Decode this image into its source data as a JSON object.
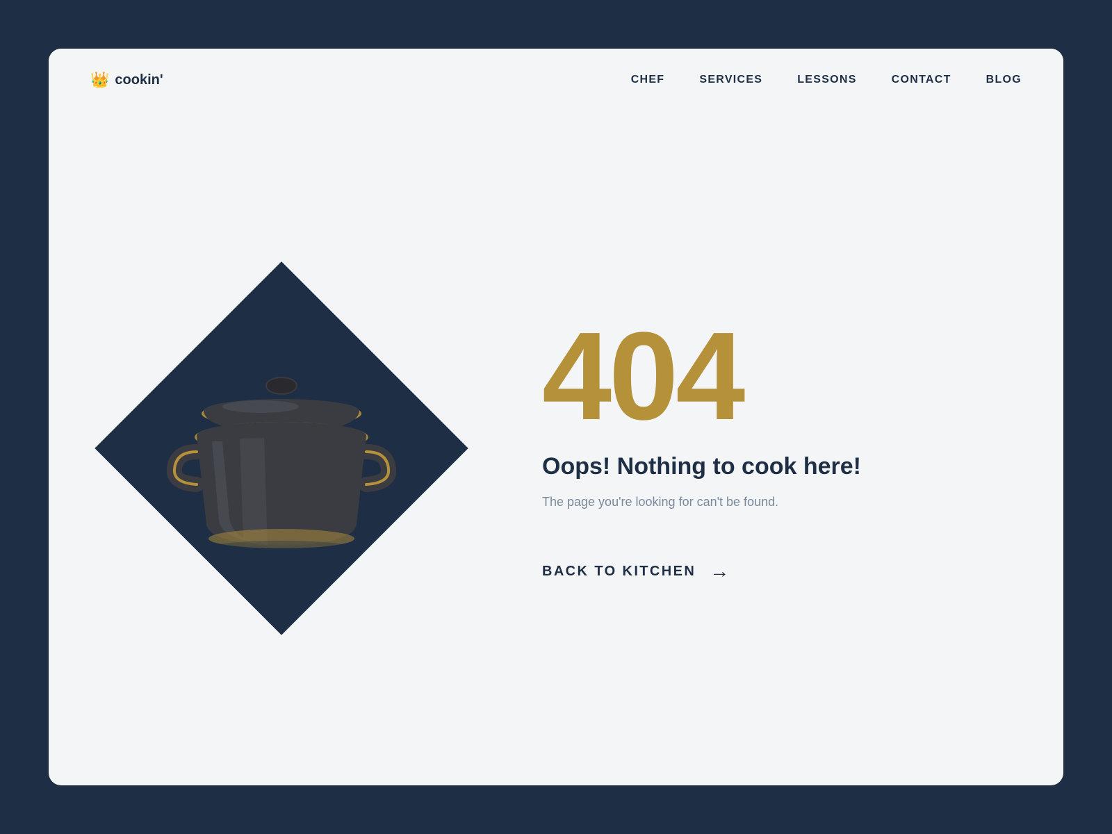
{
  "header": {
    "logo_text": "cookin'",
    "logo_icon": "👑",
    "nav_items": [
      {
        "label": "CHEF",
        "id": "chef"
      },
      {
        "label": "SERVICES",
        "id": "services"
      },
      {
        "label": "LESSONS",
        "id": "lessons"
      },
      {
        "label": "CONTACT",
        "id": "contact"
      },
      {
        "label": "BLOG",
        "id": "blog"
      }
    ]
  },
  "main": {
    "error_code": "404",
    "error_title": "Oops! Nothing to cook here!",
    "error_desc": "The page you're looking for can't be found.",
    "back_button_label": "BACK TO KITCHEN",
    "back_arrow": "→"
  },
  "colors": {
    "navy": "#1e2e45",
    "gold": "#b5923a",
    "bg": "#f4f5f7",
    "gray_text": "#7a8a9a"
  }
}
